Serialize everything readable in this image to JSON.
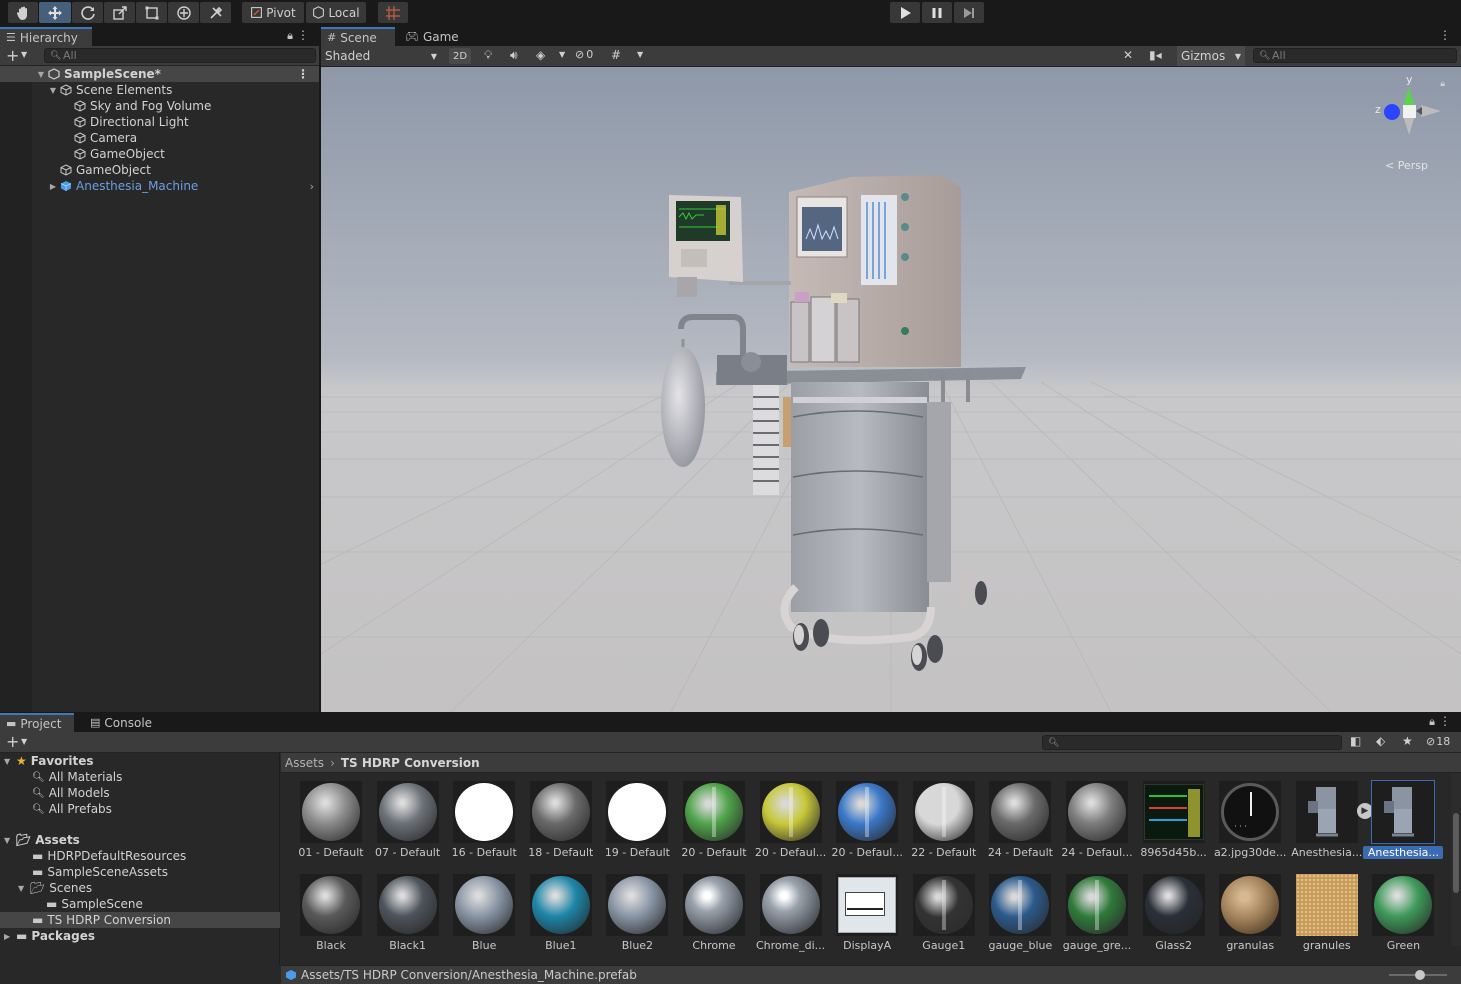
{
  "toolbar": {
    "tools": [
      "hand-tool",
      "move-tool",
      "rotate-tool",
      "scale-tool",
      "rect-tool",
      "transform-tool",
      "custom-tool"
    ],
    "pivot_label": "Pivot",
    "space_label": "Local",
    "play_controls": [
      "play",
      "pause",
      "step"
    ]
  },
  "hierarchy": {
    "tab_label": "Hierarchy",
    "search_placeholder": "All",
    "scene_name": "SampleScene*",
    "items": [
      {
        "label": "Scene Elements",
        "depth": 1,
        "expanded": true
      },
      {
        "label": "Sky and Fog Volume",
        "depth": 2
      },
      {
        "label": "Directional Light",
        "depth": 2
      },
      {
        "label": "Camera",
        "depth": 2
      },
      {
        "label": "GameObject",
        "depth": 2
      },
      {
        "label": "GameObject",
        "depth": 1
      },
      {
        "label": "Anesthesia_Machine",
        "depth": 1,
        "prefab": true
      }
    ]
  },
  "scene": {
    "tab_scene": "Scene",
    "tab_game": "Game",
    "shading_mode": "Shaded",
    "mode_2d": "2D",
    "hidden_count": "0",
    "gizmos_label": "Gizmos",
    "search_placeholder": "All",
    "gizmo_axis_y": "y",
    "gizmo_axis_z": "z",
    "projection_label": "Persp"
  },
  "project": {
    "tab_project": "Project",
    "tab_console": "Console",
    "hidden_badge": "18",
    "favorites_label": "Favorites",
    "favorites": [
      "All Materials",
      "All Models",
      "All Prefabs"
    ],
    "assets_label": "Assets",
    "asset_folders": [
      "HDRPDefaultResources",
      "SampleSceneAssets",
      "Scenes",
      "SampleScene",
      "TS HDRP Conversion"
    ],
    "packages_label": "Packages",
    "breadcrumb_root": "Assets",
    "breadcrumb_current": "TS HDRP Conversion",
    "status_path": "Assets/TS HDRP Conversion/Anesthesia_Machine.prefab",
    "assets_row1": [
      {
        "label": "01 - Default",
        "kind": "sphere",
        "color": "#8c8c8c"
      },
      {
        "label": "07 - Default",
        "kind": "sphere",
        "color": "#6c7178"
      },
      {
        "label": "16 - Default",
        "kind": "white",
        "color": "#ffffff"
      },
      {
        "label": "18 - Default",
        "kind": "sphere",
        "color": "#6a6a6a"
      },
      {
        "label": "19 - Default",
        "kind": "white",
        "color": "#ffffff"
      },
      {
        "label": "20 - Default",
        "kind": "gauge",
        "color": "#4fa34a"
      },
      {
        "label": "20 - Defaul...",
        "kind": "gauge",
        "color": "#c8c83a"
      },
      {
        "label": "20 - Defaul...",
        "kind": "gauge",
        "color": "#3a78c8"
      },
      {
        "label": "22 - Default",
        "kind": "gauge",
        "color": "#d8d8d8"
      },
      {
        "label": "24 - Default",
        "kind": "sphere",
        "color": "#6a6a6a"
      },
      {
        "label": "24 - Defaul...",
        "kind": "sphere",
        "color": "#7d7d7d"
      },
      {
        "label": "8965d45b...",
        "kind": "monitor",
        "color": "#2fbf3a"
      },
      {
        "label": "a2.jpg30de...",
        "kind": "clock",
        "color": "#111111"
      },
      {
        "label": "Anesthesia...",
        "kind": "prefab",
        "color": "#4a5460"
      },
      {
        "label": "Anesthesia...",
        "kind": "prefab",
        "color": "#4a5460",
        "selected": true
      }
    ],
    "assets_row2": [
      {
        "label": "Black",
        "kind": "sphere",
        "color": "#5a5a5a"
      },
      {
        "label": "Black1",
        "kind": "sphere",
        "color": "#4e545c"
      },
      {
        "label": "Blue",
        "kind": "sphere",
        "color": "#8a96a6"
      },
      {
        "label": "Blue1",
        "kind": "sphere",
        "color": "#1e86a8"
      },
      {
        "label": "Blue2",
        "kind": "sphere",
        "color": "#8a96a6"
      },
      {
        "label": "Chrome",
        "kind": "chrome",
        "color": "#9aa2ac"
      },
      {
        "label": "Chrome_di...",
        "kind": "chrome",
        "color": "#9aa2ac"
      },
      {
        "label": "DisplayA",
        "kind": "display",
        "color": "#e0e6ea"
      },
      {
        "label": "Gauge1",
        "kind": "gauge",
        "color": "#333333"
      },
      {
        "label": "gauge_blue",
        "kind": "gauge",
        "color": "#2b5a8c"
      },
      {
        "label": "gauge_gre...",
        "kind": "gauge",
        "color": "#2f7a3a"
      },
      {
        "label": "Glass2",
        "kind": "sphere",
        "color": "#2a3038"
      },
      {
        "label": "granulas",
        "kind": "granule",
        "color": "#a08058"
      },
      {
        "label": "granules",
        "kind": "granuleflat",
        "color": "#c89a5a"
      },
      {
        "label": "Green",
        "kind": "sphere",
        "color": "#3f9a5a"
      }
    ]
  }
}
